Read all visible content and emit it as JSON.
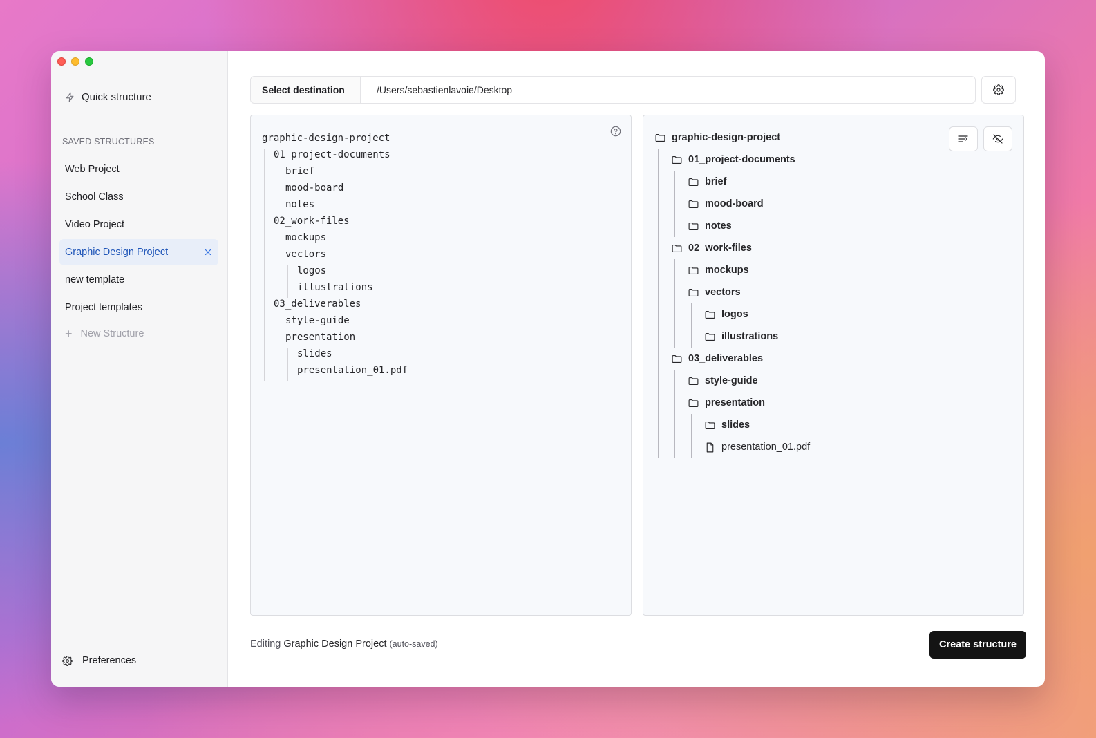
{
  "sidebar": {
    "quick_label": "Quick structure",
    "saved_header": "SAVED STRUCTURES",
    "items": [
      {
        "label": "Web Project"
      },
      {
        "label": "School Class"
      },
      {
        "label": "Video Project"
      },
      {
        "label": "Graphic Design Project",
        "active": true
      },
      {
        "label": "new template"
      },
      {
        "label": "Project templates"
      }
    ],
    "new_label": "New Structure",
    "prefs_label": "Preferences"
  },
  "destination": {
    "button_label": "Select destination",
    "path": "/Users/sebastienlavoie/Desktop"
  },
  "editor": {
    "lines": [
      {
        "depth": 0,
        "text": "graphic-design-project"
      },
      {
        "depth": 1,
        "text": "01_project-documents"
      },
      {
        "depth": 2,
        "text": "brief"
      },
      {
        "depth": 2,
        "text": "mood-board"
      },
      {
        "depth": 2,
        "text": "notes"
      },
      {
        "depth": 1,
        "text": "02_work-files"
      },
      {
        "depth": 2,
        "text": "mockups"
      },
      {
        "depth": 2,
        "text": "vectors"
      },
      {
        "depth": 3,
        "text": "logos"
      },
      {
        "depth": 3,
        "text": "illustrations"
      },
      {
        "depth": 1,
        "text": "03_deliverables"
      },
      {
        "depth": 2,
        "text": "style-guide"
      },
      {
        "depth": 2,
        "text": "presentation"
      },
      {
        "depth": 3,
        "text": "slides"
      },
      {
        "depth": 3,
        "text": "presentation_01.pdf"
      }
    ]
  },
  "tree": {
    "nodes": [
      {
        "depth": 0,
        "name": "graphic-design-project",
        "type": "folder"
      },
      {
        "depth": 1,
        "name": "01_project-documents",
        "type": "folder"
      },
      {
        "depth": 2,
        "name": "brief",
        "type": "folder"
      },
      {
        "depth": 2,
        "name": "mood-board",
        "type": "folder"
      },
      {
        "depth": 2,
        "name": "notes",
        "type": "folder"
      },
      {
        "depth": 1,
        "name": "02_work-files",
        "type": "folder"
      },
      {
        "depth": 2,
        "name": "mockups",
        "type": "folder"
      },
      {
        "depth": 2,
        "name": "vectors",
        "type": "folder"
      },
      {
        "depth": 3,
        "name": "logos",
        "type": "folder"
      },
      {
        "depth": 3,
        "name": "illustrations",
        "type": "folder"
      },
      {
        "depth": 1,
        "name": "03_deliverables",
        "type": "folder"
      },
      {
        "depth": 2,
        "name": "style-guide",
        "type": "folder"
      },
      {
        "depth": 2,
        "name": "presentation",
        "type": "folder"
      },
      {
        "depth": 3,
        "name": "slides",
        "type": "folder"
      },
      {
        "depth": 3,
        "name": "presentation_01.pdf",
        "type": "file"
      }
    ]
  },
  "footer": {
    "prefix": "Editing",
    "name": "Graphic Design Project",
    "suffix": "(auto-saved)",
    "create_label": "Create structure"
  },
  "icons": {
    "quick": "lightning-icon",
    "settings": "gear-icon",
    "help": "question-circle-icon",
    "close": "close-icon",
    "add": "plus-icon",
    "folder": "folder-icon",
    "file": "file-icon",
    "wrap": "text-wrap-icon",
    "hide": "eye-off-icon"
  },
  "colors": {
    "accent": "#1f55b8",
    "active_bg": "#e8eef9",
    "primary_button": "#141414"
  }
}
